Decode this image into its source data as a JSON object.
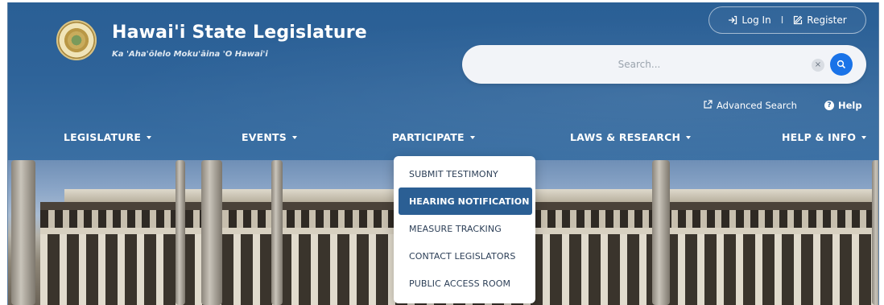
{
  "site": {
    "title": "Hawai'i State Legislature",
    "subtitle": "Ka 'Aha'ōlelo Moku'āina 'O Hawai'i"
  },
  "account": {
    "login_label": "Log In",
    "separator": "I",
    "register_label": "Register"
  },
  "search": {
    "placeholder": "Search...",
    "value": ""
  },
  "links": {
    "advanced_search": "Advanced Search",
    "help": "Help"
  },
  "nav": {
    "items": [
      {
        "label": "LEGISLATURE"
      },
      {
        "label": "EVENTS"
      },
      {
        "label": "PARTICIPATE"
      },
      {
        "label": "LAWS & RESEARCH"
      },
      {
        "label": "HELP & INFO"
      }
    ]
  },
  "dropdown": {
    "items": [
      {
        "label": "SUBMIT TESTIMONY"
      },
      {
        "label": "HEARING NOTIFICATION"
      },
      {
        "label": "MEASURE TRACKING"
      },
      {
        "label": "CONTACT LEGISLATORS"
      },
      {
        "label": "PUBLIC ACCESS ROOM"
      }
    ]
  },
  "icons": {
    "login": "login-arrow-icon",
    "register": "edit-square-icon",
    "search": "search-icon",
    "clear": "clear-icon",
    "advanced": "external-link-icon",
    "help": "question-circle-icon",
    "caret": "caret-down-icon"
  },
  "colors": {
    "header_blue": "#2e6399",
    "search_button": "#1a73e8",
    "active_item": "#2b5f94",
    "dropdown_text": "#2c3f57"
  }
}
